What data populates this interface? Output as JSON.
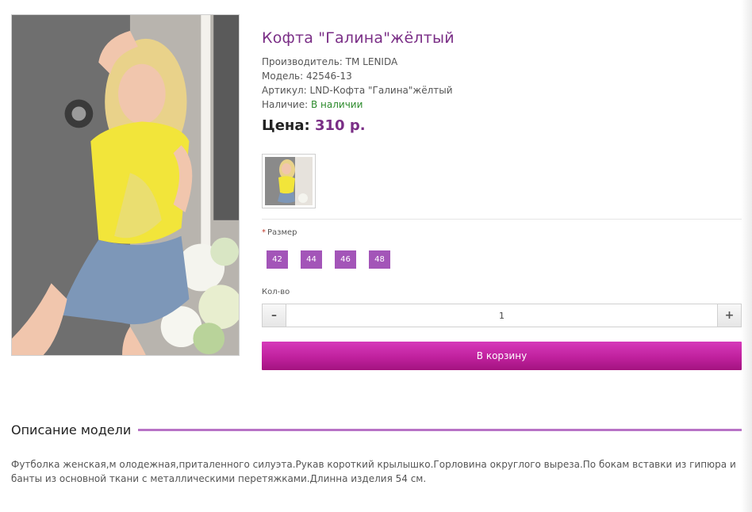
{
  "product": {
    "title": "Кофта \"Галина\"жёлтый",
    "manufacturer_label": "Производитель:",
    "manufacturer": "TM LENIDA",
    "model_label": "Модель:",
    "model": "42546-13",
    "sku_label": "Артикул:",
    "sku": "LND-Кофта \"Галина\"жёлтый",
    "availability_label": "Наличие:",
    "availability": "В наличии",
    "price_label": "Цена:",
    "price": "310 р."
  },
  "options": {
    "size_label": "Размер",
    "required_mark": "*",
    "sizes": [
      "42",
      "44",
      "46",
      "48"
    ],
    "qty_label": "Кол-во",
    "qty_value": "1",
    "qty_minus_icon": "minus-icon",
    "qty_plus_icon": "plus-icon"
  },
  "cart_button": "В корзину",
  "description": {
    "heading": "Описание модели",
    "text": "Футболка женская,м олодежная,приталенного силуэта.Рукав короткий крылышко.Горловина округлого выреза.По бокам вставки из гипюра и банты из основной ткани с металлическими перетяжками.Длинна изделия 54 см."
  },
  "colors": {
    "accent_purple": "#7a2e86",
    "size_button": "#a355b8",
    "cart_button": "#c0219e",
    "in_stock": "#2b8a2b"
  }
}
